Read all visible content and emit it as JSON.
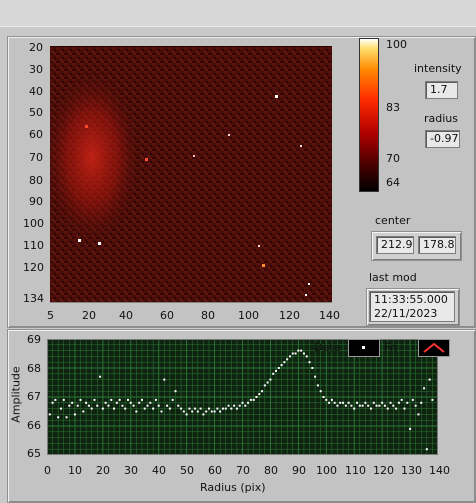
{
  "image_panel": {
    "y_ticks": [
      "20",
      "30",
      "40",
      "50",
      "60",
      "70",
      "80",
      "90",
      "100",
      "110",
      "120",
      "134"
    ],
    "x_ticks": [
      "5",
      "20",
      "40",
      "60",
      "80",
      "100",
      "120",
      "140"
    ]
  },
  "colorbar": {
    "ticks": [
      "100",
      "83",
      "70",
      "64"
    ]
  },
  "intensity": {
    "label": "intensity",
    "value": "1.7"
  },
  "radius": {
    "label": "radius",
    "value": "-0.97"
  },
  "center": {
    "label": "center",
    "x": "212.9",
    "y": "178.8"
  },
  "last_mod": {
    "label": "last mod",
    "time": "11:33:55.000",
    "date": "22/11/2023"
  },
  "plot": {
    "ylabel": "Amplitude",
    "xlabel": "Radius (pix)",
    "y_ticks": [
      "69",
      "68",
      "67",
      "66",
      "65"
    ],
    "x_ticks": [
      "0",
      "10",
      "20",
      "30",
      "40",
      "50",
      "60",
      "70",
      "80",
      "90",
      "100",
      "110",
      "120",
      "130",
      "140"
    ],
    "legend": {
      "data_label": "Data",
      "fit_label": "Fit"
    },
    "colors": {
      "background": "#0e2410",
      "grid": "#2f7a35",
      "points": "#ffffff",
      "fit": "#ff3333"
    }
  },
  "chart_data": {
    "type": "scatter",
    "xlabel": "Radius (pix)",
    "ylabel": "Amplitude",
    "xlim": [
      0,
      140
    ],
    "ylim": [
      65,
      69
    ],
    "grid": true,
    "legend": "top-right",
    "series": [
      {
        "name": "Data",
        "x": [
          0,
          1,
          2,
          3,
          4,
          5,
          6,
          7,
          8,
          9,
          10,
          11,
          12,
          13,
          14,
          15,
          16,
          17,
          18,
          19,
          20,
          21,
          22,
          23,
          24,
          25,
          26,
          27,
          28,
          29,
          30,
          31,
          32,
          33,
          34,
          35,
          36,
          37,
          38,
          39,
          40,
          41,
          42,
          43,
          44,
          45,
          46,
          47,
          48,
          49,
          50,
          51,
          52,
          53,
          54,
          55,
          56,
          57,
          58,
          59,
          60,
          61,
          62,
          63,
          64,
          65,
          66,
          67,
          68,
          69,
          70,
          71,
          72,
          73,
          74,
          75,
          76,
          77,
          78,
          79,
          80,
          81,
          82,
          83,
          84,
          85,
          86,
          87,
          88,
          89,
          90,
          91,
          92,
          93,
          94,
          95,
          96,
          97,
          98,
          99,
          100,
          101,
          102,
          103,
          104,
          105,
          106,
          107,
          108,
          109,
          110,
          111,
          112,
          113,
          114,
          115,
          116,
          117,
          118,
          119,
          120,
          121,
          122,
          123,
          124,
          125,
          126,
          127,
          128,
          129,
          130,
          131,
          132,
          133,
          134,
          135,
          136,
          137,
          138
        ],
        "y": [
          66.9,
          66.4,
          66.8,
          66.9,
          66.3,
          66.6,
          66.9,
          66.3,
          66.7,
          66.8,
          66.4,
          66.7,
          66.9,
          66.5,
          66.8,
          66.7,
          66.6,
          66.9,
          66.7,
          67.7,
          66.6,
          66.8,
          66.7,
          66.9,
          66.6,
          66.8,
          66.9,
          66.7,
          66.6,
          66.9,
          66.8,
          66.7,
          66.5,
          66.8,
          66.9,
          66.6,
          66.7,
          66.8,
          66.6,
          66.9,
          66.7,
          66.5,
          67.6,
          66.7,
          66.6,
          66.9,
          67.2,
          66.7,
          66.6,
          66.5,
          66.4,
          66.6,
          66.5,
          66.6,
          66.5,
          66.6,
          66.4,
          66.5,
          66.6,
          66.5,
          66.5,
          66.6,
          66.5,
          66.6,
          66.6,
          66.7,
          66.6,
          66.7,
          66.6,
          66.7,
          66.8,
          66.7,
          66.8,
          66.9,
          66.9,
          67.0,
          67.1,
          67.2,
          67.4,
          67.5,
          67.6,
          67.8,
          67.9,
          68.0,
          68.1,
          68.2,
          68.3,
          68.4,
          68.5,
          68.5,
          68.6,
          68.6,
          68.5,
          68.4,
          68.2,
          68.0,
          67.7,
          67.4,
          67.2,
          67.0,
          66.9,
          66.8,
          66.9,
          66.8,
          66.7,
          66.8,
          66.8,
          66.7,
          66.8,
          66.7,
          66.6,
          66.8,
          66.7,
          66.7,
          66.8,
          66.7,
          66.6,
          66.8,
          66.7,
          66.7,
          66.8,
          66.7,
          66.6,
          66.8,
          66.7,
          66.6,
          66.8,
          66.9,
          66.6,
          66.8,
          65.9,
          66.9,
          66.7,
          66.4,
          66.8,
          67.3,
          65.2,
          67.6,
          66.9
        ]
      }
    ]
  }
}
